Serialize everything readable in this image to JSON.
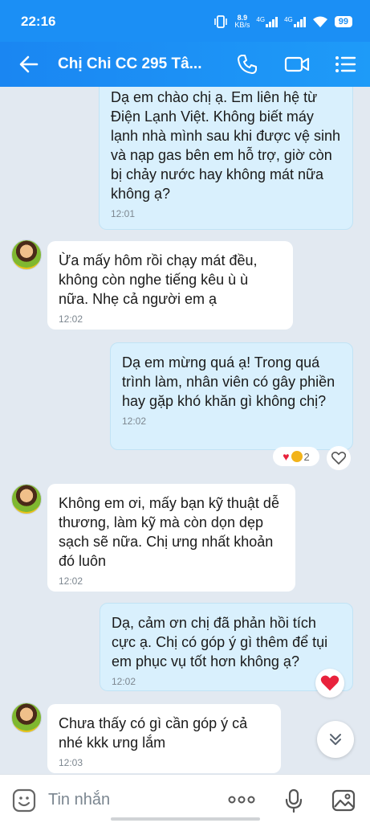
{
  "status": {
    "time": "22:16",
    "net_speed_value": "8.9",
    "net_speed_unit": "KB/s",
    "net_1": "4G",
    "net_2": "4G",
    "battery": "99"
  },
  "header": {
    "title": "Chị Chi CC 295 Tâ..."
  },
  "messages": [
    {
      "dir": "out",
      "text": "Dạ em chào chị ạ. Em liên hệ từ Điện Lạnh Việt. Không biết máy lạnh nhà mình sau khi được vệ sinh và nạp gas bên em hỗ trợ, giờ còn bị chảy nước hay không mát nữa không ạ?",
      "time": "12:01"
    },
    {
      "dir": "in",
      "text": "Ừa mấy hôm rồi chạy mát đều, không còn nghe tiếng kêu ù ù nữa. Nhẹ cả người em ạ",
      "time": "12:02"
    },
    {
      "dir": "out",
      "text": "Dạ em mừng quá ạ! Trong quá trình làm, nhân viên có gây phiền hay gặp khó khăn gì không chị?",
      "time": "12:02"
    },
    {
      "dir": "in",
      "text": "Không em ơi, mấy bạn kỹ thuật dễ thương, làm kỹ mà còn dọn dẹp sạch sẽ nữa. Chị ưng nhất khoản đó luôn",
      "time": "12:02"
    },
    {
      "dir": "out",
      "text": "Dạ, cảm ơn chị đã phản hồi tích cực ạ. Chị có góp ý gì thêm để tụi em phục vụ tốt hơn không ạ?",
      "time": "12:02"
    },
    {
      "dir": "in",
      "text": "Chưa thấy có gì cần góp ý cả nhé kkk ưng lắm",
      "time": "12:03"
    }
  ],
  "reactions": {
    "count": "2"
  },
  "input": {
    "placeholder": "Tin nhắn"
  },
  "colors": {
    "header": "#1b8ff5",
    "outgoing_bubble": "#d9f0fd",
    "incoming_bubble": "#ffffff",
    "background": "#e2e9f1"
  }
}
